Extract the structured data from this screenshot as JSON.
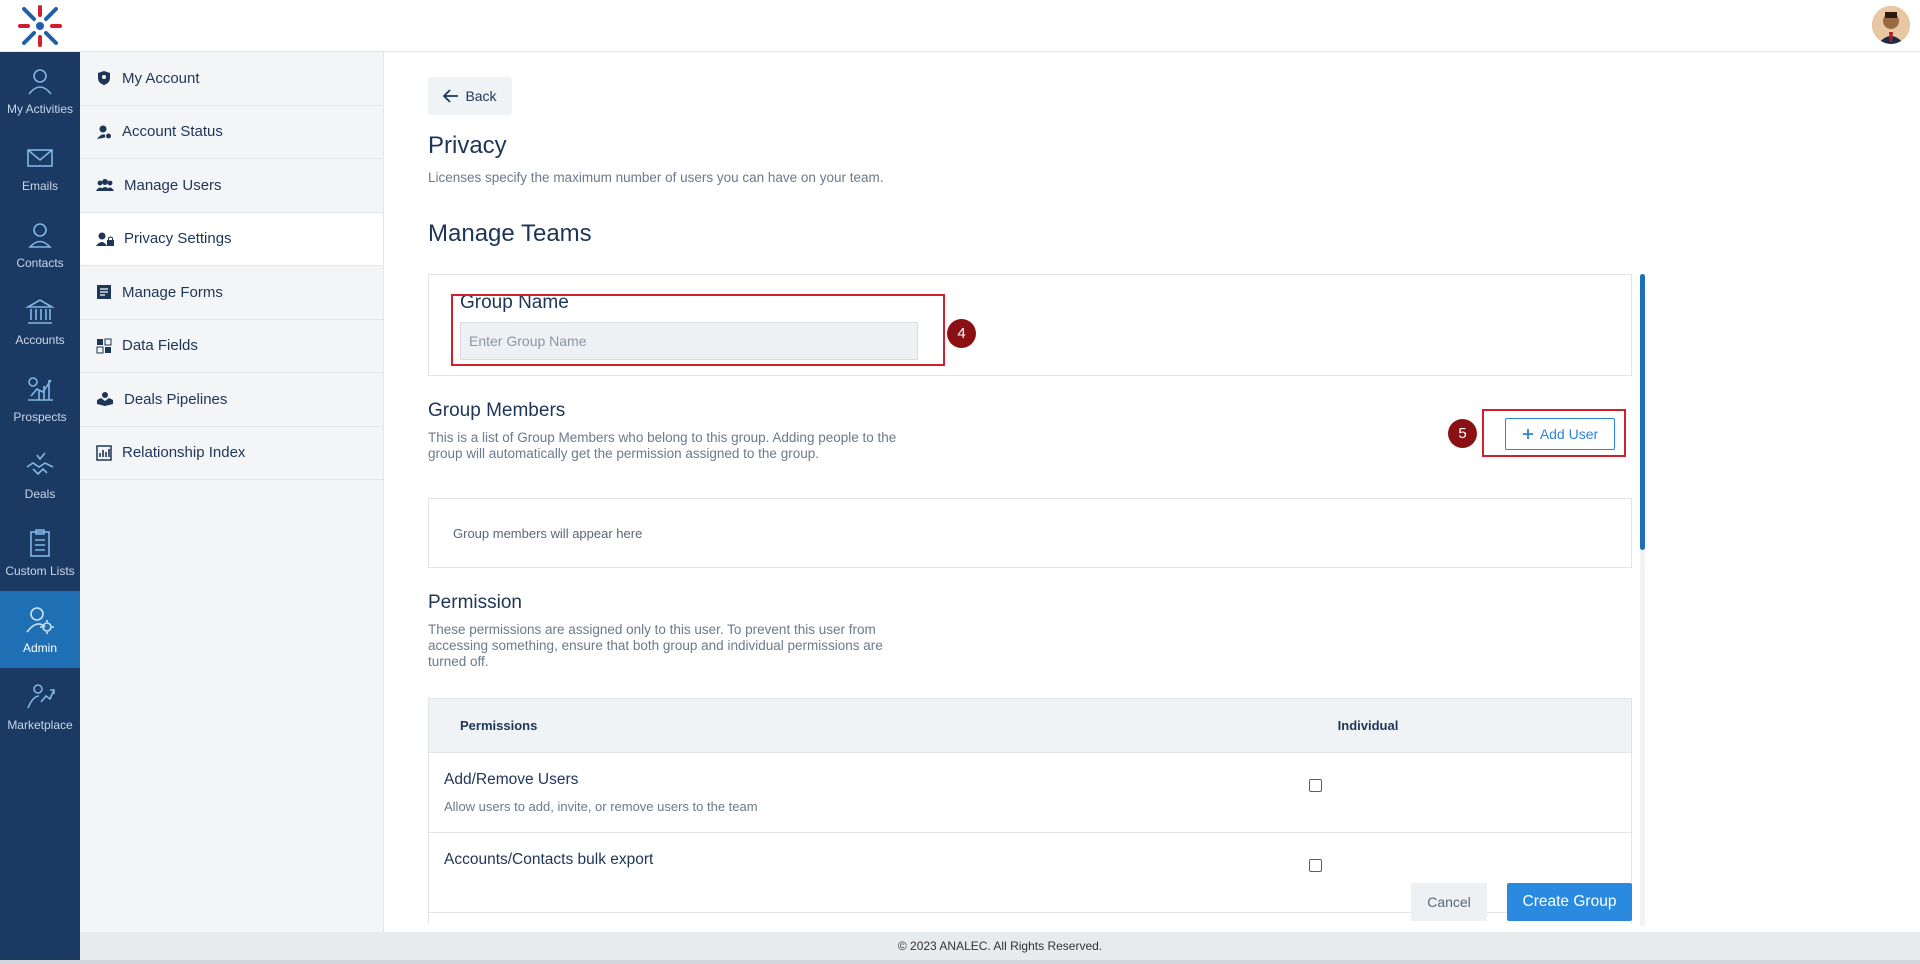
{
  "leftnav": {
    "items": [
      {
        "label": "My Activities",
        "icon": "user-activity-icon"
      },
      {
        "label": "Emails",
        "icon": "mail-icon"
      },
      {
        "label": "Contacts",
        "icon": "contact-icon"
      },
      {
        "label": "Accounts",
        "icon": "bank-icon"
      },
      {
        "label": "Prospects",
        "icon": "prospects-icon"
      },
      {
        "label": "Deals",
        "icon": "handshake-icon"
      },
      {
        "label": "Custom Lists",
        "icon": "clipboard-list-icon"
      },
      {
        "label": "Admin",
        "icon": "admin-gear-icon"
      },
      {
        "label": "Marketplace",
        "icon": "marketplace-icon"
      }
    ],
    "active": "Admin"
  },
  "sidebar": {
    "items": [
      {
        "label": "My Account",
        "icon": "shield-user-icon"
      },
      {
        "label": "Account Status",
        "icon": "user-status-icon"
      },
      {
        "label": "Manage Users",
        "icon": "users-icon"
      },
      {
        "label": "Privacy Settings",
        "icon": "user-lock-icon"
      },
      {
        "label": "Manage Forms",
        "icon": "form-icon"
      },
      {
        "label": "Data Fields",
        "icon": "grid-icon"
      },
      {
        "label": "Deals Pipelines",
        "icon": "pipeline-icon"
      },
      {
        "label": "Relationship Index",
        "icon": "index-icon"
      }
    ],
    "active": "Privacy Settings"
  },
  "main": {
    "back_label": "Back",
    "title": "Privacy",
    "description": "Licenses specify the maximum number of users you can have on your team.",
    "section_title": "Manage Teams",
    "group_name": {
      "label": "Group Name",
      "placeholder": "Enter Group Name",
      "value": ""
    },
    "badge_group": "4",
    "badge_add": "5",
    "members": {
      "title": "Group Members",
      "description": "This is a list of Group Members who belong to this group. Adding people to the group will automatically get the permission assigned to the group.",
      "add_label": "Add User",
      "empty_text": "Group members will appear here"
    },
    "permission": {
      "title": "Permission",
      "description": "These permissions are assigned only to this user. To prevent this user from accessing something, ensure that both group and individual permissions are turned off.",
      "col_permissions": "Permissions",
      "col_individual": "Individual",
      "rows": [
        {
          "title": "Add/Remove Users",
          "subtitle": "Allow users to add, invite, or remove users to the team",
          "checked": false
        },
        {
          "title": "Accounts/Contacts bulk export",
          "subtitle": "",
          "checked": false
        }
      ]
    },
    "cancel_label": "Cancel",
    "create_label": "Create Group"
  },
  "footer": {
    "text": "© 2023 ANALEC. All Rights Reserved."
  },
  "colors": {
    "nav_bg": "#1b3a63",
    "nav_active": "#1f6fb4",
    "accent": "#2a8ae0",
    "highlight": "#d0202e",
    "badge": "#8b1014"
  }
}
